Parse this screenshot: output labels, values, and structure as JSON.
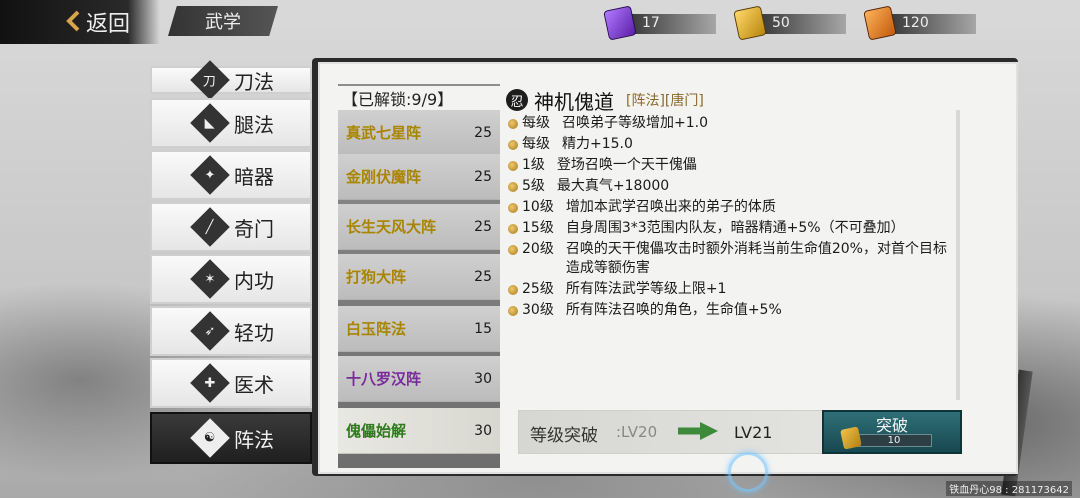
{
  "topbar": {
    "back_label": "返回",
    "section_title": "武学"
  },
  "resources": [
    {
      "icon": "purple-book-icon",
      "value": "17",
      "color": "#8a44d6"
    },
    {
      "icon": "gold-book-icon",
      "value": "50",
      "color": "#e4b02a"
    },
    {
      "icon": "orange-book-icon",
      "value": "120",
      "color": "#e4881e"
    }
  ],
  "categories": [
    {
      "label": "刀法",
      "icon": "blade-icon",
      "partial": true
    },
    {
      "label": "腿法",
      "icon": "kick-icon"
    },
    {
      "label": "暗器",
      "icon": "shuriken-icon"
    },
    {
      "label": "奇门",
      "icon": "odd-weapon-icon"
    },
    {
      "label": "内功",
      "icon": "inner-force-icon"
    },
    {
      "label": "轻功",
      "icon": "lightness-icon"
    },
    {
      "label": "医术",
      "icon": "medicine-icon"
    },
    {
      "label": "阵法",
      "icon": "yin-yang-icon",
      "active": true
    }
  ],
  "formations": {
    "unlock_label": "【已解锁:9/9】",
    "items": [
      {
        "name": "真武七星阵",
        "level": "25",
        "color": "#a98500"
      },
      {
        "name": "金刚伏魔阵",
        "level": "25",
        "color": "#a98500"
      },
      {
        "name": "长生天风大阵",
        "level": "25",
        "color": "#a98500"
      },
      {
        "name": "打狗大阵",
        "level": "25",
        "color": "#a98500"
      },
      {
        "name": "白玉阵法",
        "level": "15",
        "color": "#a98500"
      },
      {
        "name": "十八罗汉阵",
        "level": "30",
        "color": "#7a2a9a"
      },
      {
        "name": "傀儡始解",
        "level": "30",
        "color": "#2e7a1c",
        "selected": true
      }
    ]
  },
  "detail": {
    "skill_icon": "ninja-icon",
    "name": "神机傀道",
    "tags": "[阵法][唐门]",
    "effects": [
      {
        "level": "每级",
        "text": "召唤弟子等级增加+1.0"
      },
      {
        "level": "每级",
        "text": "精力+15.0"
      },
      {
        "level": "1级",
        "text": "登场召唤一个天干傀儡"
      },
      {
        "level": "5级",
        "text": "最大真气+18000"
      },
      {
        "level": "10级",
        "text": "增加本武学召唤出来的弟子的体质"
      },
      {
        "level": "15级",
        "text": "自身周围3*3范围内队友，暗器精通+5%（不可叠加）"
      },
      {
        "level": "20级",
        "text": "召唤的天干傀儡攻击时额外消耗当前生命值20%，对首个目标造成等额伤害"
      },
      {
        "level": "25级",
        "text": "所有阵法武学等级上限+1"
      },
      {
        "level": "30级",
        "text": "所有阵法召唤的角色，生命值+5%"
      }
    ]
  },
  "breakthrough": {
    "label": "等级突破",
    "from": ":LV20",
    "to": "LV21",
    "button_label": "突破",
    "cost": "10"
  },
  "watermark": "铁血丹心98 : 281173642"
}
